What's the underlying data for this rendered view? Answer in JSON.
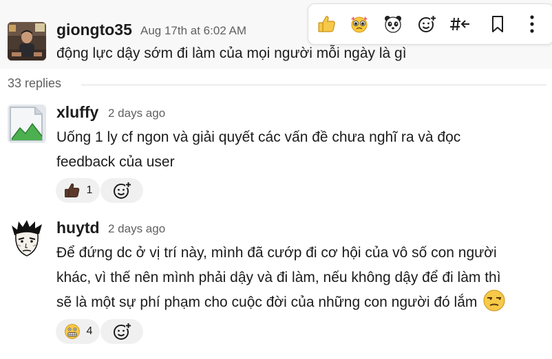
{
  "colors": {
    "top_background": "#f8f8f8",
    "text": "#1d1c1d",
    "muted": "#616061",
    "reaction_bg": "#f0f0f0",
    "divider": "#dddddd"
  },
  "parent_message": {
    "author": "giongto35",
    "timestamp": "Aug 17th at 6:02 AM",
    "text": "động lực dậy sớm đi làm của mọi người mỗi ngày là gì",
    "avatar": "user-photo-avatar"
  },
  "toolbar": {
    "actions": [
      {
        "name": "thumbs-up-icon"
      },
      {
        "name": "pleading-face-icon"
      },
      {
        "name": "panda-face-icon"
      },
      {
        "name": "add-reaction-icon"
      },
      {
        "name": "reply-in-thread-icon"
      },
      {
        "name": "bookmark-icon"
      },
      {
        "name": "more-actions-icon"
      }
    ]
  },
  "thread": {
    "replies_count_label": "33 replies"
  },
  "replies": [
    {
      "author": "xluffy",
      "timestamp": "2 days ago",
      "lines": [
        "Uống 1 ly cf ngon và giải quyết các vấn đề chưa nghĩ ra và đọc",
        "feedback của user"
      ],
      "avatar": "default-image-avatar",
      "reactions": [
        {
          "emoji": "thumbs-up-dark-skin",
          "count": "1"
        }
      ]
    },
    {
      "author": "huytd",
      "timestamp": "2 days ago",
      "lines": [
        "Để đứng dc ở vị trí này, mình đã cướp đi cơ hội của vô số con người",
        "khác, vì thế nên mình phải dậy và đi làm, nếu không dậy để đi làm thì",
        "sẽ là một sự phí phạm cho cuộc đời của những con người đó lắm"
      ],
      "inline_emoji": "unamused-face",
      "avatar": "manga-face-avatar",
      "reactions": [
        {
          "emoji": "grimacing-face",
          "count": "4"
        }
      ]
    }
  ]
}
